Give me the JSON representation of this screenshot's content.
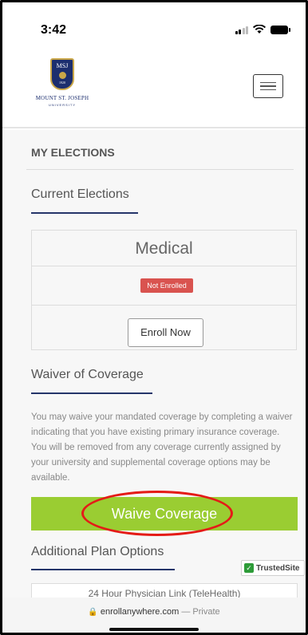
{
  "status_bar": {
    "time": "3:42",
    "icons": [
      "cellular-signal-icon",
      "wifi-icon",
      "battery-icon"
    ]
  },
  "header": {
    "logo": {
      "crest_text": "MSJ",
      "crest_year": "1920",
      "name": "MOUNT ST. JOSEPH",
      "sub": "UNIVERSITY"
    },
    "menu_icon": "hamburger-menu-icon"
  },
  "my_elections": {
    "title": "MY ELECTIONS",
    "current_elections": {
      "heading": "Current Elections",
      "card": {
        "title": "Medical",
        "status_badge": "Not Enrolled",
        "enroll_button": "Enroll Now"
      }
    },
    "waiver": {
      "heading": "Waiver of Coverage",
      "text": "You may waive your mandated coverage by completing a waiver indicating that you have existing primary insurance coverage. You will be removed from any coverage currently assigned by your university and supplemental coverage options may be available.",
      "button": "Waive Coverage"
    },
    "additional": {
      "heading": "Additional Plan Options",
      "first_item": "24 Hour Physician Link (TeleHealth)"
    }
  },
  "trusted_badge": {
    "label": "TrustedSite"
  },
  "browser": {
    "url": "enrollanywhere.com",
    "mode": "— Private"
  },
  "colors": {
    "brand_navy": "#25356a",
    "waive_green": "#9acd32",
    "badge_red": "#d9534f",
    "annotation_red": "#e41b17"
  }
}
